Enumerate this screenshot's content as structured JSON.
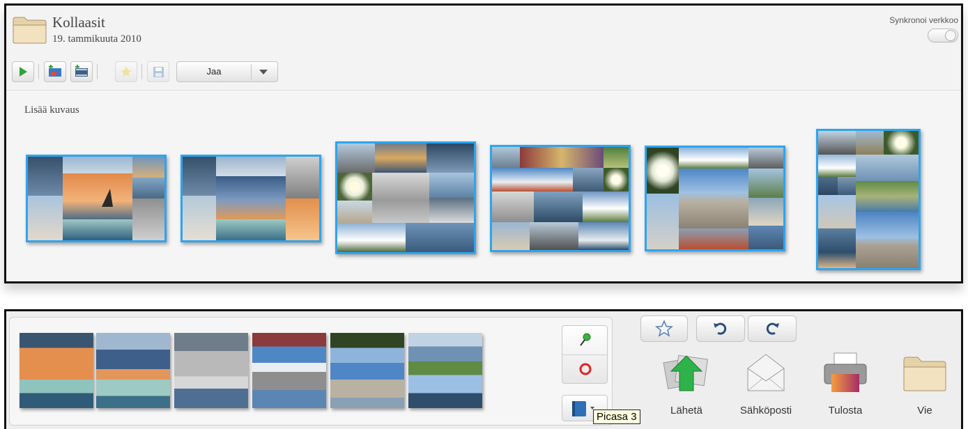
{
  "header": {
    "album_title": "Kollaasit",
    "album_date": "19. tammikuuta 2010",
    "sync_label": "Synkronoi verkkoo"
  },
  "toolbar": {
    "buttons": [
      {
        "icon": "play-icon"
      },
      {
        "icon": "add-picture-icon"
      },
      {
        "icon": "add-movie-icon"
      },
      {
        "icon": "star-icon",
        "disabled": true
      },
      {
        "icon": "save-icon",
        "disabled": true
      }
    ],
    "share_label": "Jaa"
  },
  "main": {
    "caption_placeholder": "Lisää kuvaus",
    "collage_count": 6
  },
  "bottom": {
    "tray_count": 6,
    "side_buttons": [
      "pin-icon",
      "red-eye-icon",
      "book-icon"
    ],
    "tooltip": "Picasa 3",
    "top_buttons": [
      "star-outline-icon",
      "rotate-left-icon",
      "rotate-right-icon"
    ],
    "actions": [
      {
        "label": "Lähetä",
        "icon": "upload-icon"
      },
      {
        "label": "Sähköposti",
        "icon": "email-icon"
      },
      {
        "label": "Tulosta",
        "icon": "printer-icon"
      },
      {
        "label": "Vie",
        "icon": "folder-icon"
      }
    ]
  },
  "colors": {
    "selection_border": "#2ea4ef",
    "panel_border": "#111111",
    "tooltip_bg": "#ffffe1"
  }
}
